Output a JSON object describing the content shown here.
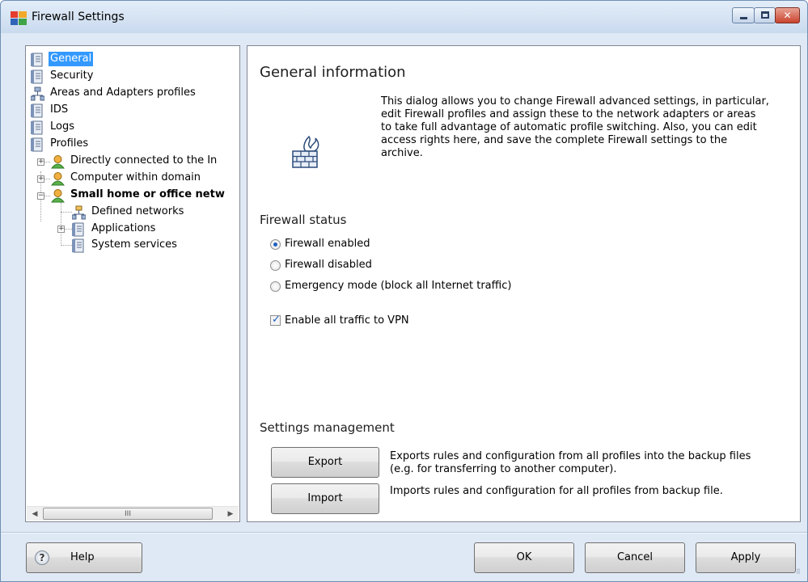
{
  "window": {
    "title": "Firewall Settings",
    "controls": {
      "minimize": "minimize",
      "maximize": "maximize",
      "close": "✕"
    }
  },
  "tree": {
    "items": [
      {
        "label": "General",
        "icon": "document-icon",
        "selected": true
      },
      {
        "label": "Security",
        "icon": "document-icon"
      },
      {
        "label": "Areas and Adapters profiles",
        "icon": "network-icon"
      },
      {
        "label": "IDS",
        "icon": "document-icon"
      },
      {
        "label": "Logs",
        "icon": "document-icon"
      },
      {
        "label": "Profiles",
        "icon": "document-icon"
      },
      {
        "label": "Directly connected to the In",
        "icon": "user-icon"
      },
      {
        "label": "Computer within domain",
        "icon": "user-icon"
      },
      {
        "label": "Small home or office netw",
        "icon": "user-icon",
        "bold": true
      },
      {
        "label": "Defined networks",
        "icon": "network-icon"
      },
      {
        "label": "Applications",
        "icon": "document-icon"
      },
      {
        "label": "System services",
        "icon": "document-icon"
      }
    ],
    "scroll_thumb_grip": "III"
  },
  "main": {
    "general_title": "General information",
    "description": "This dialog allows you to change Firewall advanced settings, in particular, edit Firewall profiles and assign these to the network adapters or areas to take full advantage of automatic profile switching. Also, you can edit access rights here, and save the complete Firewall settings to the archive.",
    "status_title": "Firewall status",
    "radios": [
      {
        "label": "Firewall enabled",
        "checked": true
      },
      {
        "label": "Firewall disabled",
        "checked": false
      },
      {
        "label": "Emergency mode (block all Internet traffic)",
        "checked": false
      }
    ],
    "vpn_checkbox": {
      "label": "Enable all traffic to VPN",
      "checked": true
    },
    "management_title": "Settings management",
    "export_button": "Export",
    "export_desc": "Exports rules and configuration from all profiles into the backup files (e.g. for transferring to another computer).",
    "import_button": "Import",
    "import_desc": "Imports rules and configuration for all profiles from backup file."
  },
  "footer": {
    "help": "Help",
    "help_glyph": "?",
    "ok": "OK",
    "cancel": "Cancel",
    "apply": "Apply"
  }
}
